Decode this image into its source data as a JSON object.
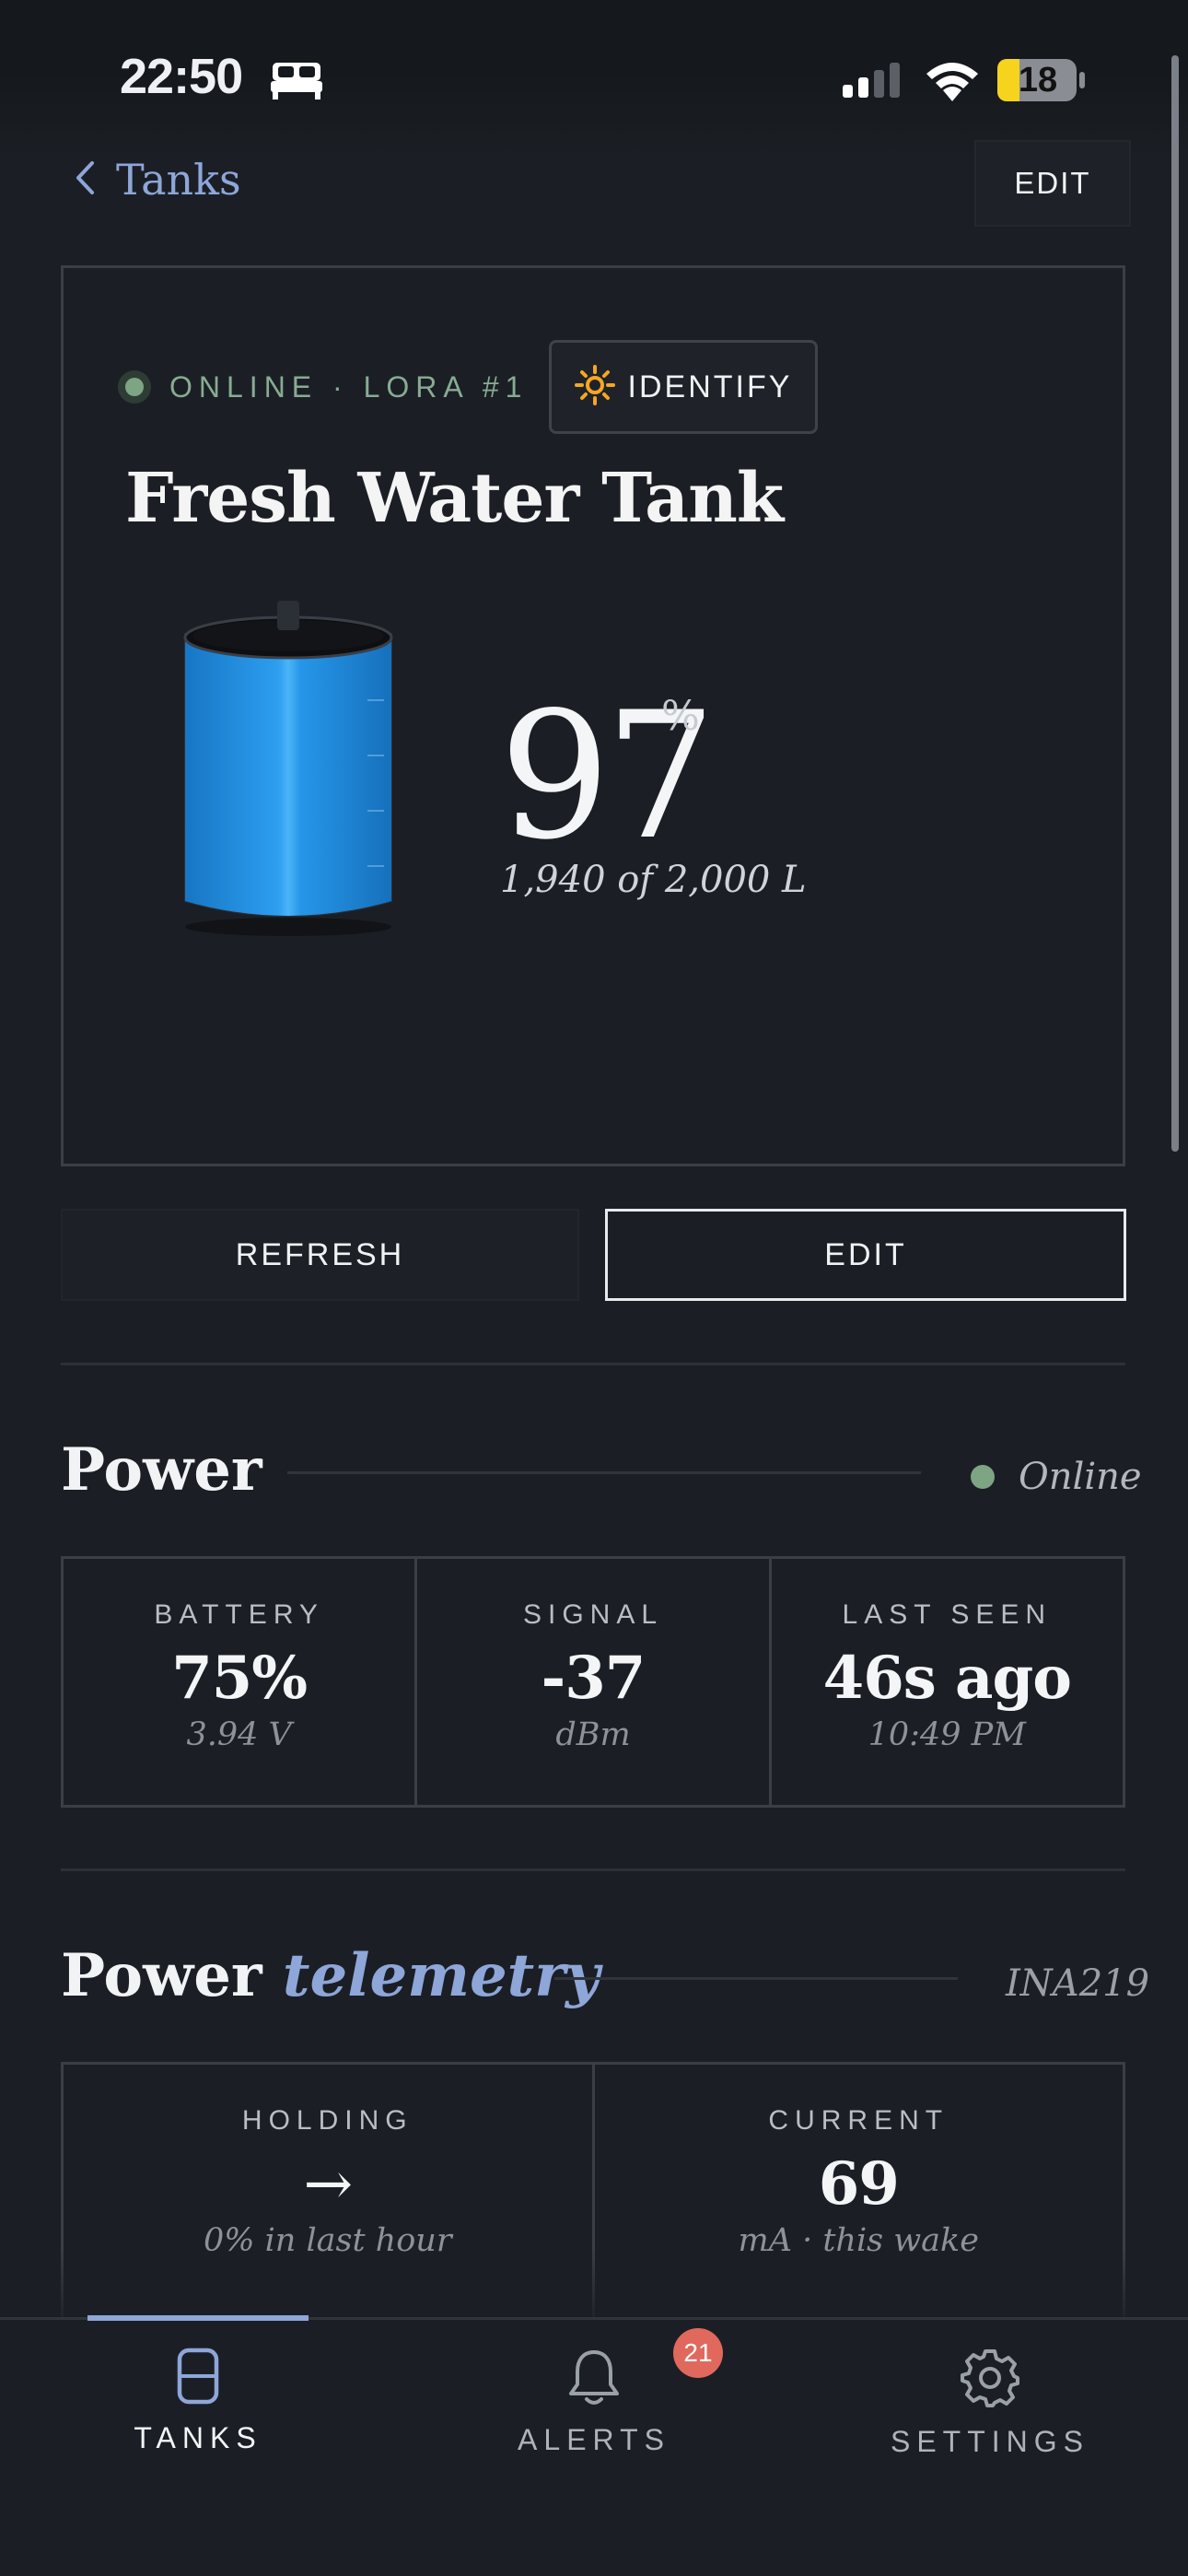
{
  "status_bar": {
    "time": "22:50",
    "battery_level": "18",
    "icons": [
      "bed-icon",
      "cellular-signal-icon",
      "wifi-icon",
      "battery-icon"
    ]
  },
  "nav": {
    "back_label": "Tanks",
    "edit_label": "EDIT"
  },
  "tank": {
    "status": "ONLINE · LORA #1",
    "identify_label": "IDENTIFY",
    "name": "Fresh Water Tank",
    "level_percent": 97,
    "level_display": "97",
    "level_unit": "%",
    "volume_text": "1,940 of 2,000 L",
    "colors": {
      "water": "#1a8fe0",
      "online": "#7da584",
      "accent": "#8ea6d8"
    }
  },
  "actions": {
    "refresh_label": "REFRESH",
    "edit_label": "EDIT"
  },
  "power": {
    "title": "Power",
    "status_label": "Online",
    "stats": [
      {
        "label": "BATTERY",
        "value": "75%",
        "sub": "3.94 V"
      },
      {
        "label": "SIGNAL",
        "value": "-37",
        "sub": "dBm"
      },
      {
        "label": "LAST SEEN",
        "value": "46s ago",
        "sub": "10:49 PM"
      }
    ]
  },
  "telemetry": {
    "title": "Power",
    "title_accent": "telemetry",
    "chip": "INA219",
    "stats": [
      {
        "label": "HOLDING",
        "value": "→",
        "sub": "0% in last hour"
      },
      {
        "label": "CURRENT",
        "value": "69",
        "sub": "mA · this wake"
      }
    ]
  },
  "tabs": [
    {
      "label": "TANKS",
      "icon": "tank-icon",
      "active": true
    },
    {
      "label": "ALERTS",
      "icon": "bell-icon",
      "badge": "21"
    },
    {
      "label": "SETTINGS",
      "icon": "gear-icon"
    }
  ]
}
